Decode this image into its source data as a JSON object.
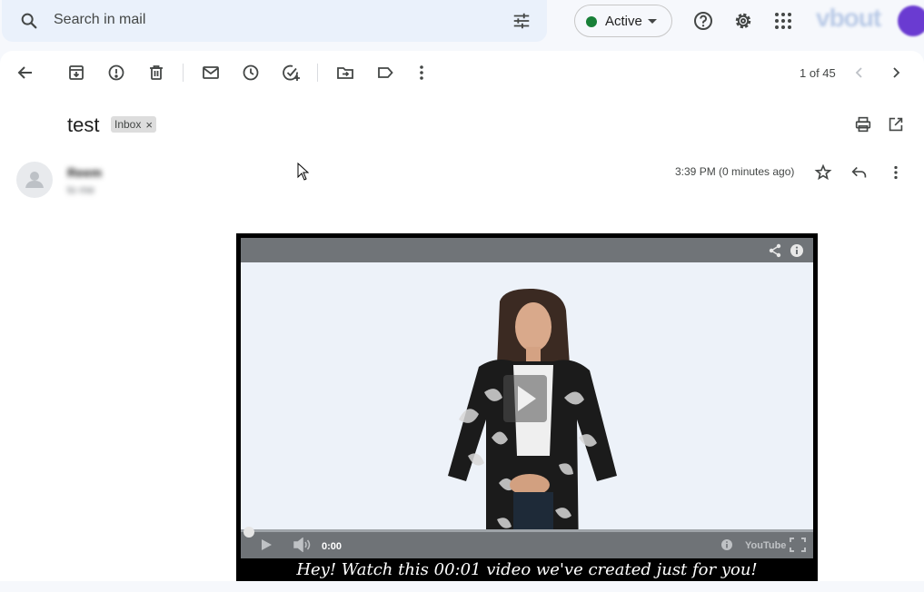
{
  "search": {
    "placeholder": "Search in mail"
  },
  "status": {
    "label": "Active",
    "color": "#188038"
  },
  "header_icons": [
    "help-icon",
    "settings-icon",
    "apps-icon"
  ],
  "toolbar": {
    "actions": [
      "back",
      "archive",
      "report-spam",
      "delete",
      "mark-unread",
      "snooze",
      "add-to-tasks",
      "move-to",
      "labels",
      "more"
    ],
    "pager_text": "1 of 45"
  },
  "email": {
    "subject": "test",
    "label_chip": "Inbox",
    "sender_name": "Reem",
    "sender_to": "to me",
    "timestamp": "3:39 PM (0 minutes ago)"
  },
  "video": {
    "current_time": "0:00",
    "caption": "Hey! Watch this 00:01 video we've created just for you!",
    "youtube_text": "YouTube"
  },
  "colors": {
    "background": "#f6f8fc",
    "search_bg": "#eaf1fb",
    "panel": "#ffffff"
  }
}
